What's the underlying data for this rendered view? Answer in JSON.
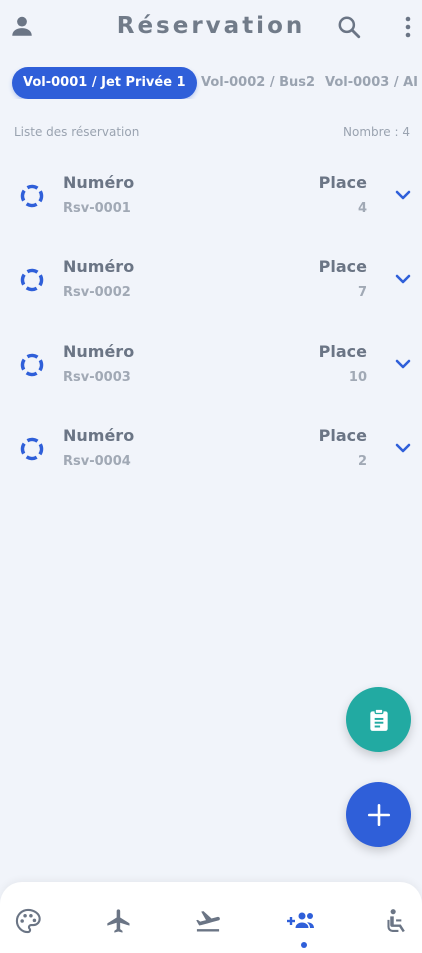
{
  "header": {
    "title": "Réservation",
    "icons": [
      "user-icon",
      "search-icon",
      "more-vert-icon"
    ]
  },
  "tabs": [
    {
      "label": "Vol-0001 / Jet Privée 1",
      "active": true
    },
    {
      "label": "Vol-0002 / Bus2",
      "active": false
    },
    {
      "label": "Vol-0003 / AI",
      "active": false
    }
  ],
  "list": {
    "title": "Liste des réservation",
    "count_label": "Nombre :  4",
    "items": [
      {
        "num_label": "Numéro",
        "num": "Rsv-0001",
        "place_label": "Place",
        "place": "4"
      },
      {
        "num_label": "Numéro",
        "num": "Rsv-0002",
        "place_label": "Place",
        "place": "7"
      },
      {
        "num_label": "Numéro",
        "num": "Rsv-0003",
        "place_label": "Place",
        "place": "10"
      },
      {
        "num_label": "Numéro",
        "num": "Rsv-0004",
        "place_label": "Place",
        "place": "2"
      }
    ]
  },
  "fabs": [
    "clipboard-icon",
    "plus-icon"
  ],
  "bottom_nav": {
    "items": [
      "palette-icon",
      "airplane-icon",
      "flight-takeoff-icon",
      "group-add-icon",
      "seat-icon"
    ],
    "active": "group-add-icon"
  },
  "colors": {
    "accent": "#2f5fd9",
    "teal": "#22aaa2",
    "background": "#f1f4fa",
    "text": "#6b7585"
  }
}
